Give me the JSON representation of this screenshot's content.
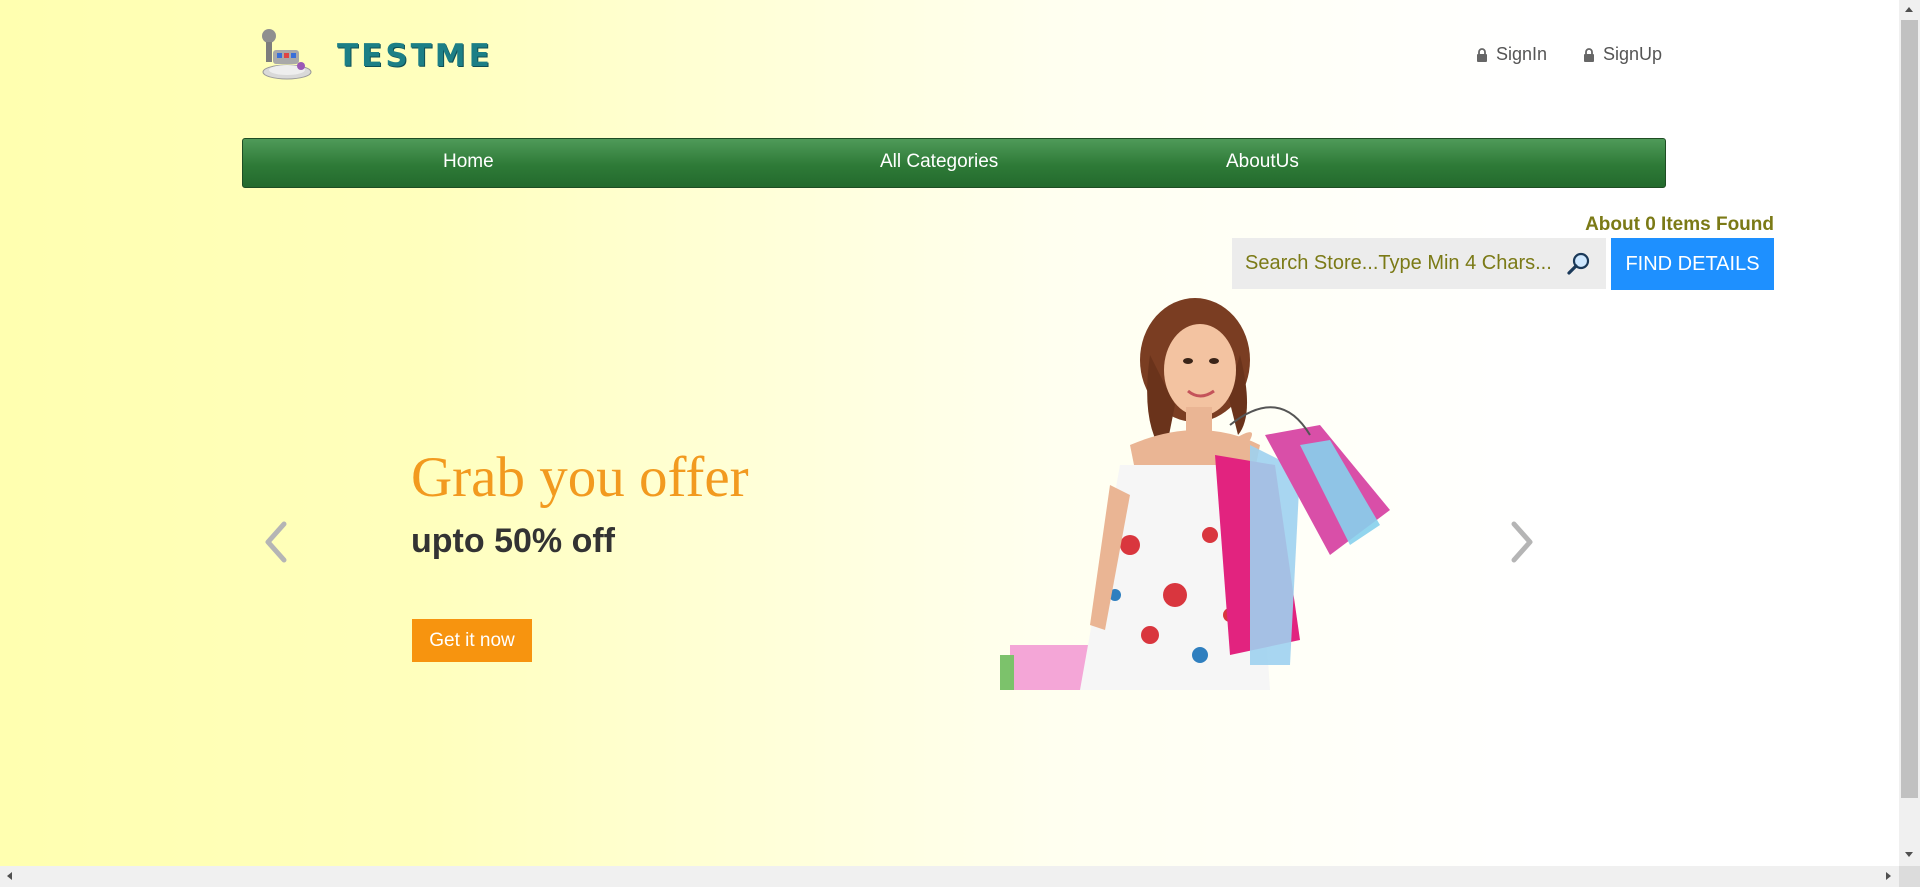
{
  "header": {
    "logo_text": "TESTME",
    "signin_label": "SignIn",
    "signup_label": "SignUp"
  },
  "nav": {
    "items": [
      {
        "label": "Home"
      },
      {
        "label": "All Categories"
      },
      {
        "label": "AboutUs"
      }
    ]
  },
  "search": {
    "items_found": "About 0 Items Found",
    "placeholder": "Search Store...Type Min 4 Chars...",
    "value": "",
    "button_label": "FIND DETAILS"
  },
  "carousel": {
    "headline": "Grab you offer",
    "subline": "upto 50% off",
    "cta_label": "Get it now",
    "hero_alt": "woman with shopping bags"
  },
  "colors": {
    "nav_green": "#2e7a37",
    "accent_orange": "#f7940f",
    "search_button_blue": "#1e90ff",
    "olive_text": "#7b7a16",
    "logo_teal": "#1c7f86"
  },
  "icons": [
    "robot-logo-icon",
    "lock-icon",
    "search-icon",
    "chevron-left-icon",
    "chevron-right-icon"
  ]
}
